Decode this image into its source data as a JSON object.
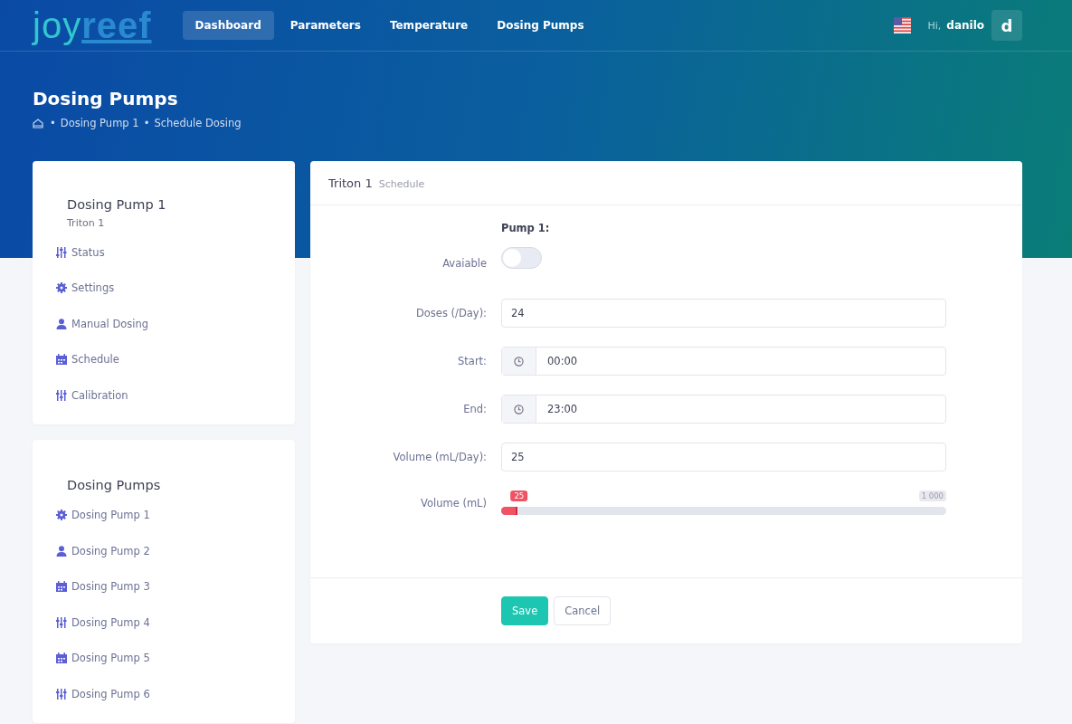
{
  "logo": {
    "light": "joy",
    "bold": "reef"
  },
  "nav": [
    {
      "label": "Dashboard",
      "selected": true
    },
    {
      "label": "Parameters",
      "selected": false
    },
    {
      "label": "Temperature",
      "selected": false
    },
    {
      "label": "Dosing Pumps",
      "selected": false
    }
  ],
  "user": {
    "greeting": "Hi,",
    "name": "danilo",
    "avatar": "d"
  },
  "page": {
    "title": "Dosing Pumps",
    "breadcrumb": [
      {
        "separator": "•",
        "label": "Dosing Pump 1"
      },
      {
        "separator": "•",
        "label": "Schedule Dosing"
      }
    ]
  },
  "pump_menu": {
    "title": "Dosing Pump 1",
    "subtitle": "Triton 1",
    "items": [
      {
        "label": "Status",
        "kind": "sliders-v"
      },
      {
        "label": "Settings",
        "kind": "gear"
      },
      {
        "label": "Manual Dosing",
        "kind": "user"
      },
      {
        "label": "Schedule",
        "kind": "calendar"
      },
      {
        "label": "Calibration",
        "kind": "sliders"
      }
    ]
  },
  "pumps_menu": {
    "title": "Dosing Pumps",
    "items": [
      {
        "label": "Dosing Pump 1",
        "kind": "gear"
      },
      {
        "label": "Dosing Pump 2",
        "kind": "user"
      },
      {
        "label": "Dosing Pump 3",
        "kind": "calendar"
      },
      {
        "label": "Dosing Pump 4",
        "kind": "sliders"
      },
      {
        "label": "Dosing Pump 5",
        "kind": "calendar"
      },
      {
        "label": "Dosing Pump 6",
        "kind": "sliders"
      }
    ]
  },
  "form": {
    "title": "Triton 1",
    "subtitle": "Schedule",
    "heading": "Pump 1:",
    "fields": [
      {
        "kind": "toggle",
        "label": "Avaiable",
        "on": false
      },
      {
        "kind": "text",
        "label": "Doses (/Day):",
        "value": "24"
      },
      {
        "kind": "time",
        "label": "Start:",
        "value": "00:00"
      },
      {
        "kind": "time",
        "label": "End:",
        "value": "23:00"
      },
      {
        "kind": "text",
        "label": "Volume (mL/Day):",
        "value": "25"
      },
      {
        "kind": "slider",
        "label": "Volume (mL)",
        "level": 0.025,
        "reading": "25",
        "max": "1 000"
      }
    ],
    "buttons": [
      {
        "label": "Save",
        "kind": "primary"
      },
      {
        "label": "Cancel",
        "kind": "secondary"
      }
    ]
  }
}
